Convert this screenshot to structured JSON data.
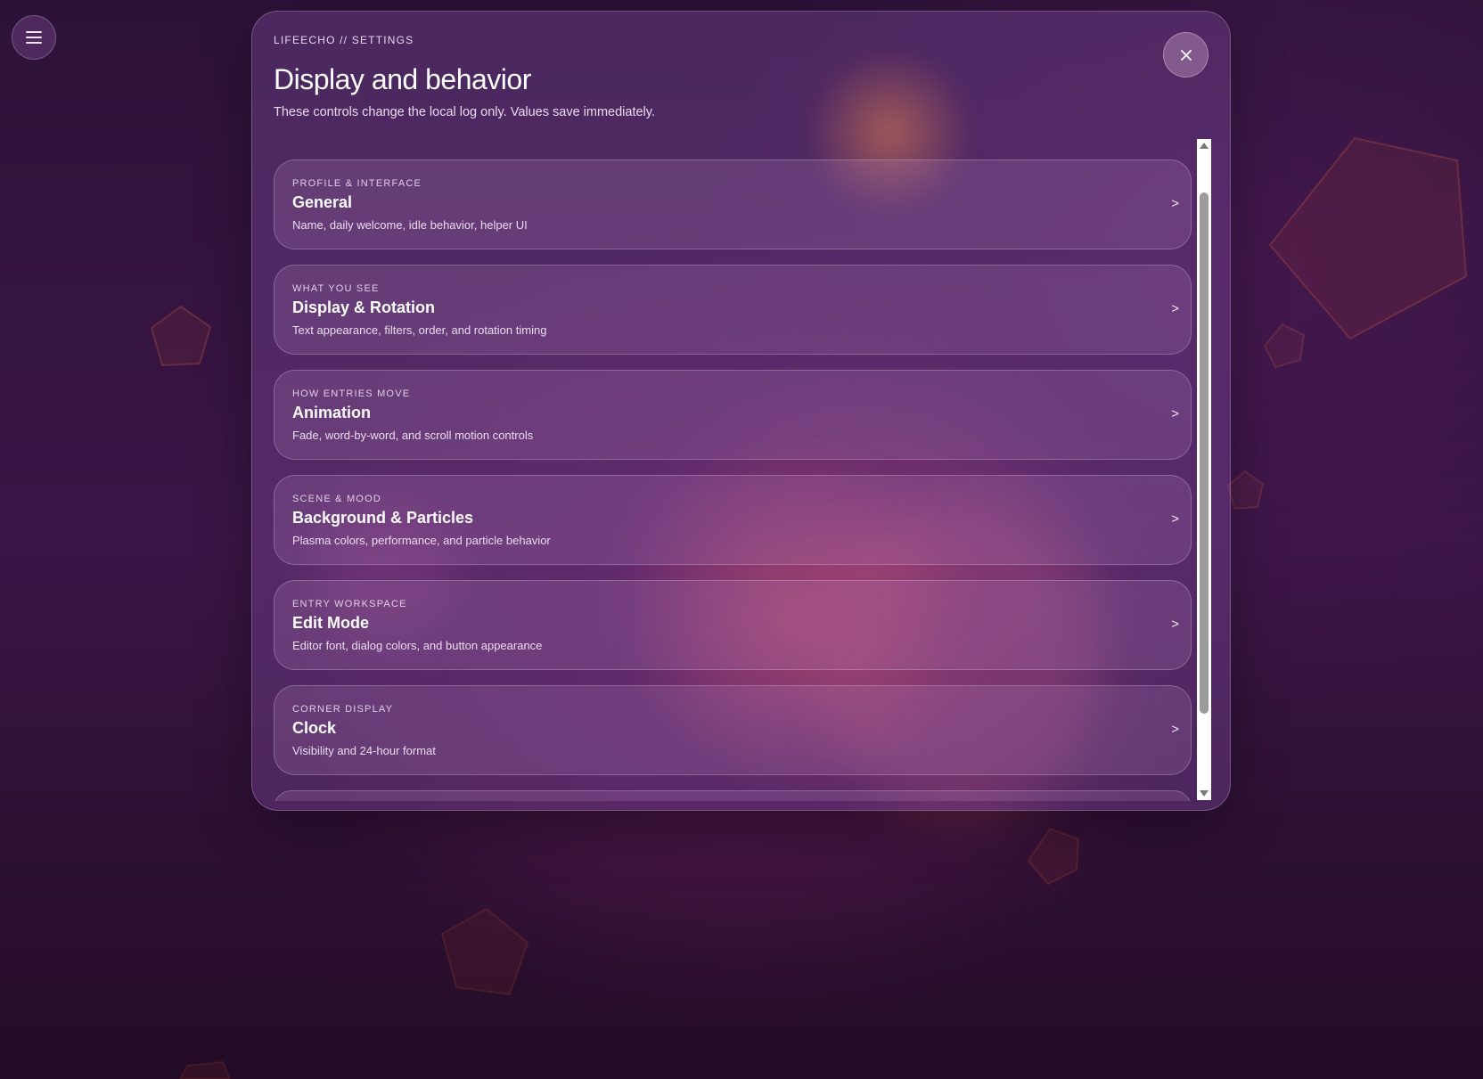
{
  "menu": {
    "icon": "hamburger-menu-icon"
  },
  "settings": {
    "eyebrow": "LIFEECHO // SETTINGS",
    "title": "Display and behavior",
    "subtitle": "These controls change the local log only. Values save immediately.",
    "close_icon": "close-icon",
    "sections": [
      {
        "kicker": "PROFILE & INTERFACE",
        "title": "General",
        "description": "Name, daily welcome, idle behavior, helper UI",
        "chevron": ">"
      },
      {
        "kicker": "WHAT YOU SEE",
        "title": "Display & Rotation",
        "description": "Text appearance, filters, order, and rotation timing",
        "chevron": ">"
      },
      {
        "kicker": "HOW ENTRIES MOVE",
        "title": "Animation",
        "description": "Fade, word-by-word, and scroll motion controls",
        "chevron": ">"
      },
      {
        "kicker": "SCENE & MOOD",
        "title": "Background & Particles",
        "description": "Plasma colors, performance, and particle behavior",
        "chevron": ">"
      },
      {
        "kicker": "ENTRY WORKSPACE",
        "title": "Edit Mode",
        "description": "Editor font, dialog colors, and button appearance",
        "chevron": ">"
      },
      {
        "kicker": "CORNER DISPLAY",
        "title": "Clock",
        "description": "Visibility and 24-hour format",
        "chevron": ">"
      }
    ]
  },
  "colors": {
    "background_dark": "#2c1238",
    "accent_glow": "#e68250",
    "panel_tint": "#784696"
  }
}
